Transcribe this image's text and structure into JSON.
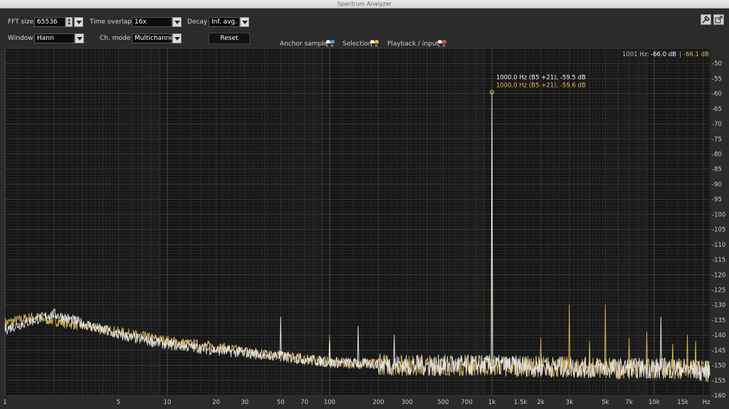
{
  "window": {
    "title": "Spectrum Analyzer"
  },
  "controls": {
    "fft_size_label": "FFT size",
    "fft_size_value": "65536",
    "time_overlap_label": "Time overlap",
    "time_overlap_value": "16x",
    "decay_label": "Decay",
    "decay_value": "Inf. avg.",
    "window_label": "Window",
    "window_value": "Hann",
    "ch_mode_label": "Ch. mode",
    "ch_mode_value": "Multichannel",
    "reset_label": "Reset"
  },
  "legend": {
    "anchor_label": "Anchor sample",
    "selection_label": "Selection",
    "playback_label": "Playback / input",
    "l_letter": "L",
    "r_letter": "R",
    "colors": {
      "anchor_l": "#e8e8e8",
      "anchor_r": "#3fa0e0",
      "selection_l": "#e8e8e8",
      "selection_r": "#e8b030",
      "playback_l": "#e8e8e8",
      "playback_r": "#e05030"
    }
  },
  "readout": {
    "freq_label": "1001 Hz:",
    "white_value": "-66.0 dB",
    "separator": "|",
    "yellow_value": "-66.1 dB"
  },
  "peak_annotation": {
    "line1": "1000.0 Hz (B5 +21), -59.5 dB",
    "line2": "1000.0 Hz (B5 +21), -59.6 dB"
  },
  "icons": {
    "tools_icon": "wrench-icon",
    "popout_icon": "popout-icon"
  },
  "colors": {
    "white_trace": "#e6e6e6",
    "yellow_trace": "#d9b55a",
    "plot_bg": "#151515",
    "grid": "#3a3a3a"
  },
  "chart_data": {
    "type": "line",
    "x_scale": "log",
    "xlim": [
      1,
      22000
    ],
    "ylim": [
      -160,
      -45
    ],
    "x_ticks": [
      "1",
      "5",
      "10",
      "20",
      "30",
      "50",
      "70",
      "100",
      "200",
      "300",
      "500",
      "700",
      "1k",
      "1.5k",
      "2k",
      "3k",
      "5k",
      "7k",
      "10k",
      "15k",
      "Hz"
    ],
    "y_ticks": [
      "-50",
      "-55",
      "-60",
      "-65",
      "-70",
      "-75",
      "-80",
      "-85",
      "-90",
      "-95",
      "-100",
      "-105",
      "-110",
      "-115",
      "-120",
      "-125",
      "-130",
      "-135",
      "-140",
      "-145",
      "-150",
      "-155",
      "-160"
    ],
    "series": [
      {
        "color": "#e6e6e6",
        "noise_floor": [
          [
            1,
            -138
          ],
          [
            2,
            -133
          ],
          [
            5,
            -140
          ],
          [
            10,
            -143
          ],
          [
            20,
            -145
          ],
          [
            50,
            -147
          ],
          [
            100,
            -149
          ],
          [
            300,
            -150
          ],
          [
            1000,
            -150
          ],
          [
            5000,
            -151
          ],
          [
            15000,
            -151
          ],
          [
            21000,
            -152
          ]
        ],
        "peaks": [
          [
            50,
            -134
          ],
          [
            100,
            -142
          ],
          [
            150,
            -137
          ],
          [
            250,
            -140
          ],
          [
            1000,
            -59.5
          ],
          [
            11000,
            -134
          ]
        ]
      },
      {
        "color": "#d9b55a",
        "noise_floor": [
          [
            1,
            -136
          ],
          [
            1.5,
            -134
          ],
          [
            5,
            -139
          ],
          [
            10,
            -142
          ],
          [
            20,
            -144
          ],
          [
            50,
            -147
          ],
          [
            100,
            -149
          ],
          [
            300,
            -150
          ],
          [
            1000,
            -150
          ],
          [
            5000,
            -151
          ],
          [
            15000,
            -151
          ],
          [
            21000,
            -152
          ]
        ],
        "peaks": [
          [
            100,
            -140
          ],
          [
            1000,
            -59.6
          ],
          [
            2000,
            -141
          ],
          [
            3000,
            -130
          ],
          [
            4000,
            -142
          ],
          [
            5000,
            -130
          ],
          [
            7000,
            -141
          ],
          [
            9000,
            -139
          ],
          [
            13000,
            -143
          ],
          [
            16000,
            -140
          ],
          [
            18000,
            -142
          ]
        ]
      }
    ]
  }
}
